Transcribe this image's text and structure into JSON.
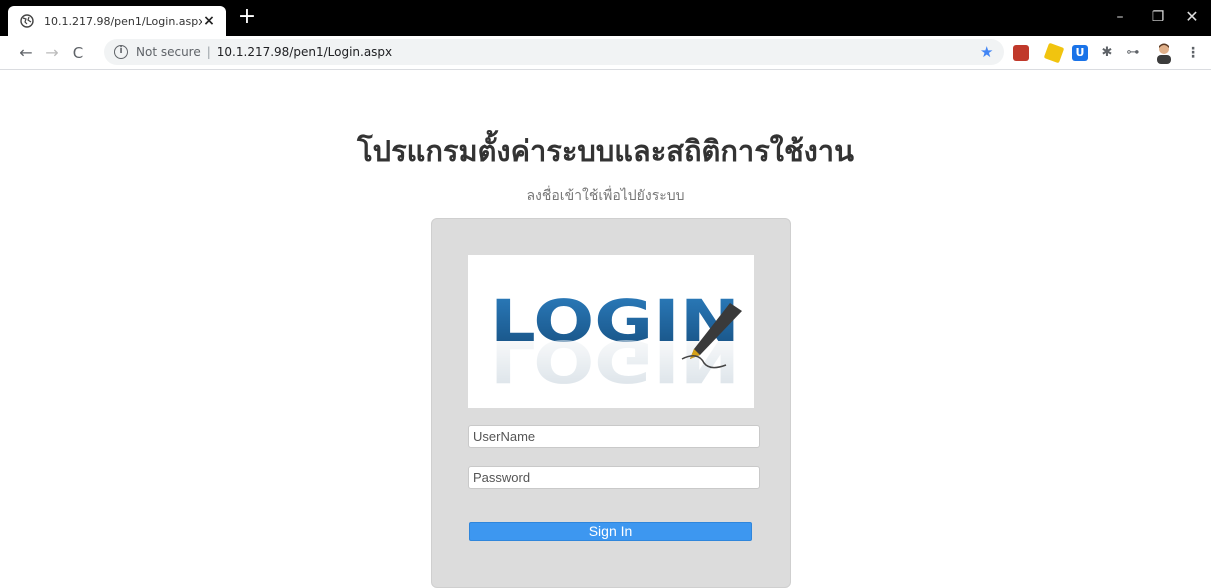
{
  "browser": {
    "tab": {
      "title": "10.1.217.98/pen1/Login.aspx",
      "close": "×"
    },
    "new_tab": "+",
    "window_controls": {
      "minimize": "–",
      "maximize": "❐",
      "close": "✕"
    },
    "nav": {
      "back": "←",
      "forward": "→",
      "reload": "C"
    },
    "omnibox": {
      "info": "i",
      "security_label": "Not secure",
      "separator": "|",
      "url": "10.1.217.98/pen1/Login.aspx"
    },
    "star": "★",
    "extensions": [
      {
        "icon": "title-extension-icon"
      },
      {
        "icon": "eyedropper-extension-icon"
      },
      {
        "icon": "u-extension-icon",
        "label": "U"
      },
      {
        "icon": "puzzle-extensions-icon",
        "label": "✱"
      },
      {
        "icon": "key-icon",
        "label": "⊶"
      }
    ],
    "menu": "⋮"
  },
  "page": {
    "heading": "โปรแกรมตั้งค่าระบบและสถิติการใช้งาน",
    "subheading": "ลงชื่อเข้าใช้เพื่อไปยังระบบ",
    "logo_text": "LOGIN",
    "form": {
      "username_placeholder": "UserName",
      "password_placeholder": "Password",
      "signin_label": "Sign In"
    }
  },
  "colors": {
    "accent": "#3d97f0",
    "panel": "#dcdcdc",
    "logo_blue": "#1f5f96"
  }
}
